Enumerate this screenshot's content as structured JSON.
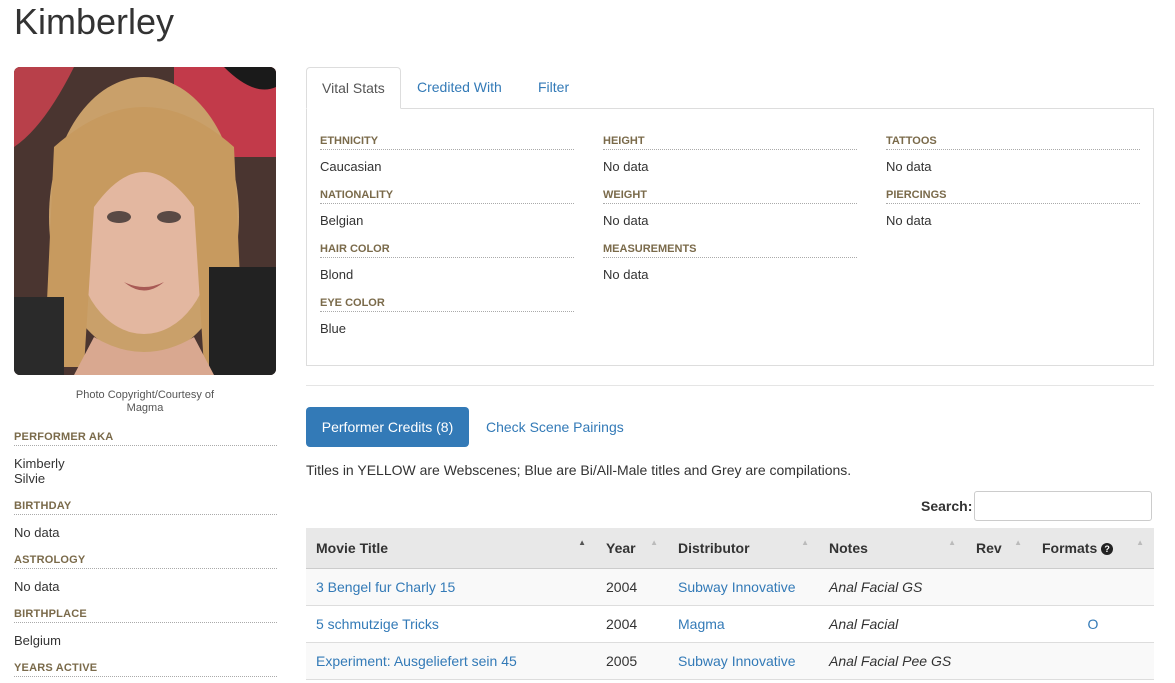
{
  "page": {
    "title": "Kimberley"
  },
  "photo": {
    "caption_line1": "Photo Copyright/Courtesy of",
    "caption_line2": "Magma"
  },
  "sidebar": {
    "aka_label": "PERFORMER AKA",
    "aka_values": [
      "Kimberly",
      "Silvie"
    ],
    "birthday_label": "BIRTHDAY",
    "birthday_value": "No data",
    "astrology_label": "ASTROLOGY",
    "astrology_value": "No data",
    "birthplace_label": "BIRTHPLACE",
    "birthplace_value": "Belgium",
    "years_active_label": "YEARS ACTIVE"
  },
  "tabs": [
    "Vital Stats",
    "Credited With",
    "Filter"
  ],
  "stats": {
    "ethnicity": {
      "label": "ETHNICITY",
      "value": "Caucasian"
    },
    "nationality": {
      "label": "NATIONALITY",
      "value": "Belgian"
    },
    "hair_color": {
      "label": "HAIR COLOR",
      "value": "Blond"
    },
    "eye_color": {
      "label": "EYE COLOR",
      "value": "Blue"
    },
    "height": {
      "label": "HEIGHT",
      "value": "No data"
    },
    "weight": {
      "label": "WEIGHT",
      "value": "No data"
    },
    "measurements": {
      "label": "MEASUREMENTS",
      "value": "No data"
    },
    "tattoos": {
      "label": "TATTOOS",
      "value": "No data"
    },
    "piercings": {
      "label": "PIERCINGS",
      "value": "No data"
    }
  },
  "credits": {
    "button_label": "Performer Credits (8)",
    "pairings_label": "Check Scene Pairings",
    "note": "Titles in YELLOW are Webscenes; Blue are Bi/All-Male titles and Grey are compilations.",
    "search_label": "Search:",
    "search_value": "",
    "columns": [
      "Movie Title",
      "Year",
      "Distributor",
      "Notes",
      "Rev",
      "Formats"
    ],
    "rows": [
      {
        "title": "3 Bengel fur Charly 15",
        "year": "2004",
        "distributor": "Subway Innovative",
        "notes": "Anal Facial GS",
        "rev": "",
        "formats": ""
      },
      {
        "title": "5 schmutzige Tricks",
        "year": "2004",
        "distributor": "Magma",
        "notes": "Anal Facial",
        "rev": "",
        "formats": "O"
      },
      {
        "title": "Experiment: Ausgeliefert sein 45",
        "year": "2005",
        "distributor": "Subway Innovative",
        "notes": "Anal Facial Pee GS",
        "rev": "",
        "formats": ""
      }
    ]
  },
  "colors": {
    "accent": "#337ab7",
    "label": "#7a6a4a"
  }
}
